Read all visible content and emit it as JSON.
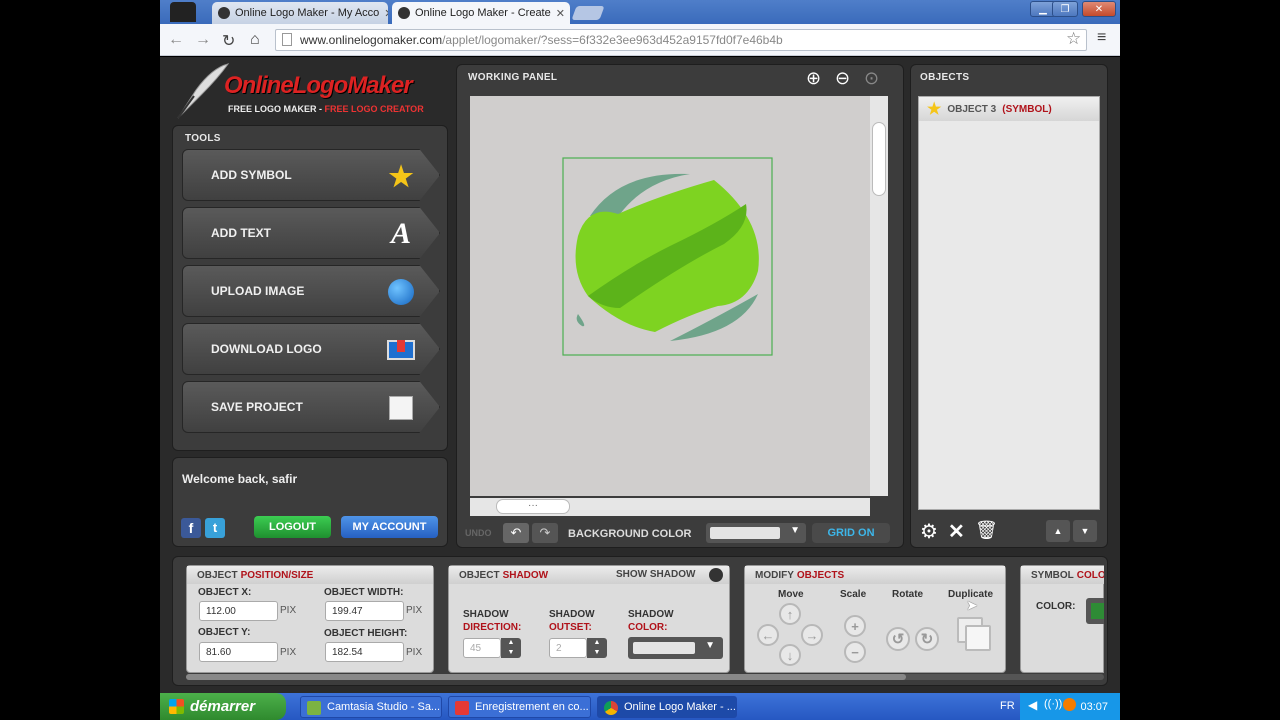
{
  "browser": {
    "tabs": [
      {
        "title": "Online Logo Maker - My Acco"
      },
      {
        "title": "Online Logo Maker - Create"
      }
    ],
    "url_prefix": "www.onlinelogomaker.com",
    "url_path": "/applet/logomaker/?sess=6f332e3ee963d452a9157fd0f7e46b4b"
  },
  "logo": {
    "brand": "OnlineLogoMaker",
    "tagline_a": "FREE LOGO MAKER",
    "sep": " - ",
    "tagline_b": "FREE LOGO CREATOR"
  },
  "tools": {
    "title": "TOOLS",
    "items": [
      {
        "label": "ADD SYMBOL"
      },
      {
        "label": "ADD TEXT"
      },
      {
        "label": "UPLOAD IMAGE"
      },
      {
        "label": "DOWNLOAD LOGO"
      },
      {
        "label": "SAVE PROJECT"
      }
    ]
  },
  "account": {
    "welcome": "Welcome back, safir",
    "logout": "LOGOUT",
    "my_account": "MY ACCOUNT"
  },
  "working_panel": {
    "title": "WORKING PANEL",
    "undo": "UNDO",
    "background_color_label": "BACKGROUND COLOR",
    "grid_button": "GRID ON",
    "scroll_thumb": "···"
  },
  "objects": {
    "title": "OBJECTS",
    "item_name": "OBJECT 3",
    "item_type": "(SYMBOL)"
  },
  "position_size": {
    "head_a": "OBJECT",
    "head_b": "POSITION/SIZE",
    "x_label": "OBJECT X:",
    "x_value": "112.00",
    "y_label": "OBJECT Y:",
    "y_value": "81.60",
    "width_label": "OBJECT WIDTH:",
    "width_value": "199.47",
    "height_label": "OBJECT HEIGHT:",
    "height_value": "182.54",
    "unit": "PIX"
  },
  "shadow": {
    "head_a": "OBJECT",
    "head_b": "SHADOW",
    "show_shadow": "SHOW SHADOW",
    "direction_a": "SHADOW",
    "direction_b": "DIRECTION:",
    "direction_value": "45",
    "outset_a": "SHADOW",
    "outset_b": "OUTSET:",
    "outset_value": "2",
    "color_a": "SHADOW",
    "color_b": "COLOR:"
  },
  "modify": {
    "head_a": "MODIFY",
    "head_b": "OBJECTS",
    "move": "Move",
    "scale": "Scale",
    "rotate": "Rotate",
    "duplicate": "Duplicate"
  },
  "symbol_color": {
    "head_a": "SYMBOL",
    "head_b": "COLOR",
    "color_label": "COLOR:",
    "swatch": "#2e8b35"
  },
  "taskbar": {
    "start": "démarrer",
    "tasks": [
      {
        "label": "Camtasia Studio - Sa..."
      },
      {
        "label": "Enregistrement en co..."
      },
      {
        "label": "Online Logo Maker - ..."
      }
    ],
    "lang": "FR",
    "clock": "03:07"
  },
  "colors": {
    "accent_red": "#b0121a",
    "logo_green": "#7ed321",
    "logo_shadow_green": "#6fa48a"
  }
}
